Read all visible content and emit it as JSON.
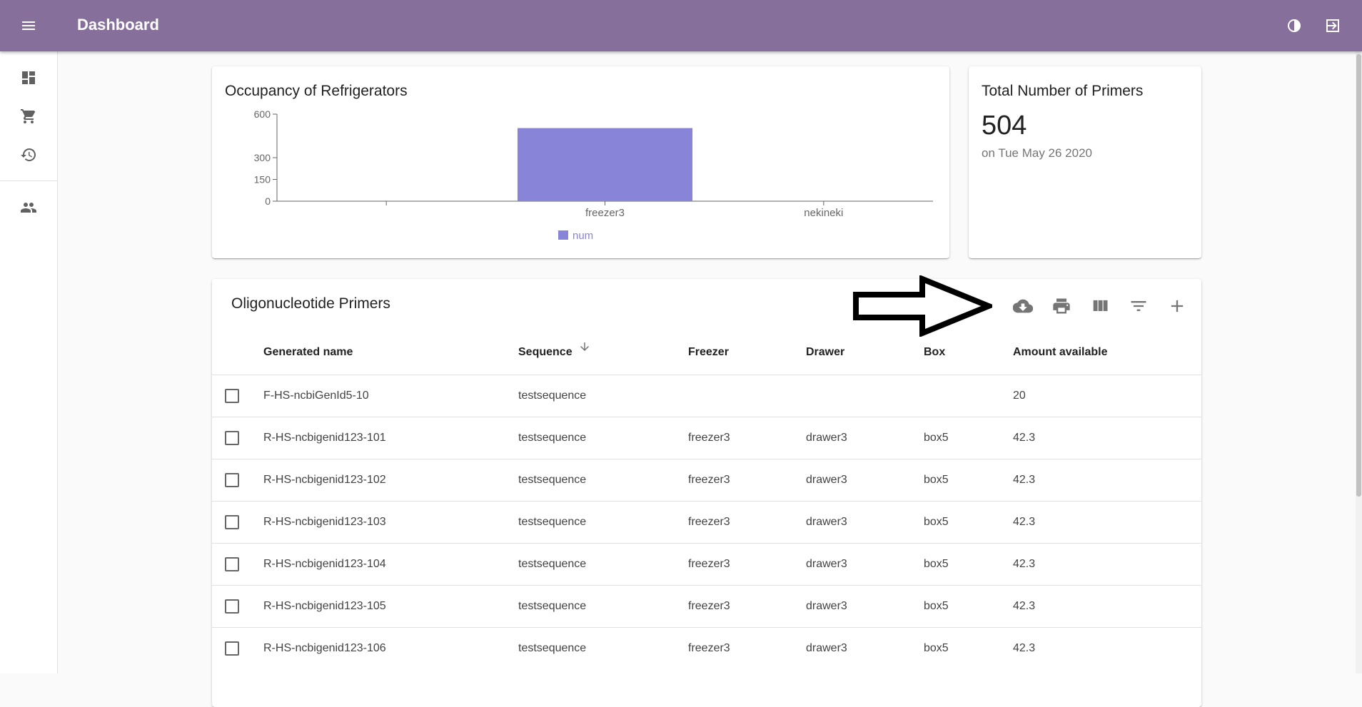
{
  "appbar": {
    "title": "Dashboard",
    "bg": "#876f9b"
  },
  "sidebar": {
    "items": [
      {
        "icon": "dashboard-icon"
      },
      {
        "icon": "cart-icon"
      },
      {
        "icon": "history-icon"
      },
      {
        "icon": "people-icon"
      }
    ]
  },
  "chart_card": {
    "title": "Occupancy of Refrigerators"
  },
  "chart_data": {
    "type": "bar",
    "categories": [
      "",
      "freezer3",
      "nekineki"
    ],
    "series": [
      {
        "name": "num",
        "values": [
          0,
          504,
          0
        ],
        "color": "#8884d8"
      }
    ],
    "yticks": [
      0,
      150,
      300,
      600
    ],
    "ylim": [
      0,
      600
    ],
    "legend": "bottom-center",
    "grid": false
  },
  "primers_card": {
    "title": "Total Number of Primers",
    "count": "504",
    "date": "on Tue May 26 2020"
  },
  "table": {
    "title": "Oligonucleotide Primers",
    "toolbar_icons": [
      "cloud-download-icon",
      "print-icon",
      "view-column-icon",
      "filter-icon",
      "add-icon"
    ],
    "columns": [
      "Generated name",
      "Sequence",
      "Freezer",
      "Drawer",
      "Box",
      "Amount available"
    ],
    "rows": [
      [
        "F-HS-ncbiGenId5-10",
        "testsequence",
        "",
        "",
        "",
        "20"
      ],
      [
        "R-HS-ncbigenid123-101",
        "testsequence",
        "freezer3",
        "drawer3",
        "box5",
        "42.3"
      ],
      [
        "R-HS-ncbigenid123-102",
        "testsequence",
        "freezer3",
        "drawer3",
        "box5",
        "42.3"
      ],
      [
        "R-HS-ncbigenid123-103",
        "testsequence",
        "freezer3",
        "drawer3",
        "box5",
        "42.3"
      ],
      [
        "R-HS-ncbigenid123-104",
        "testsequence",
        "freezer3",
        "drawer3",
        "box5",
        "42.3"
      ],
      [
        "R-HS-ncbigenid123-105",
        "testsequence",
        "freezer3",
        "drawer3",
        "box5",
        "42.3"
      ],
      [
        "R-HS-ncbigenid123-106",
        "testsequence",
        "freezer3",
        "drawer3",
        "box5",
        "42.3"
      ]
    ]
  }
}
